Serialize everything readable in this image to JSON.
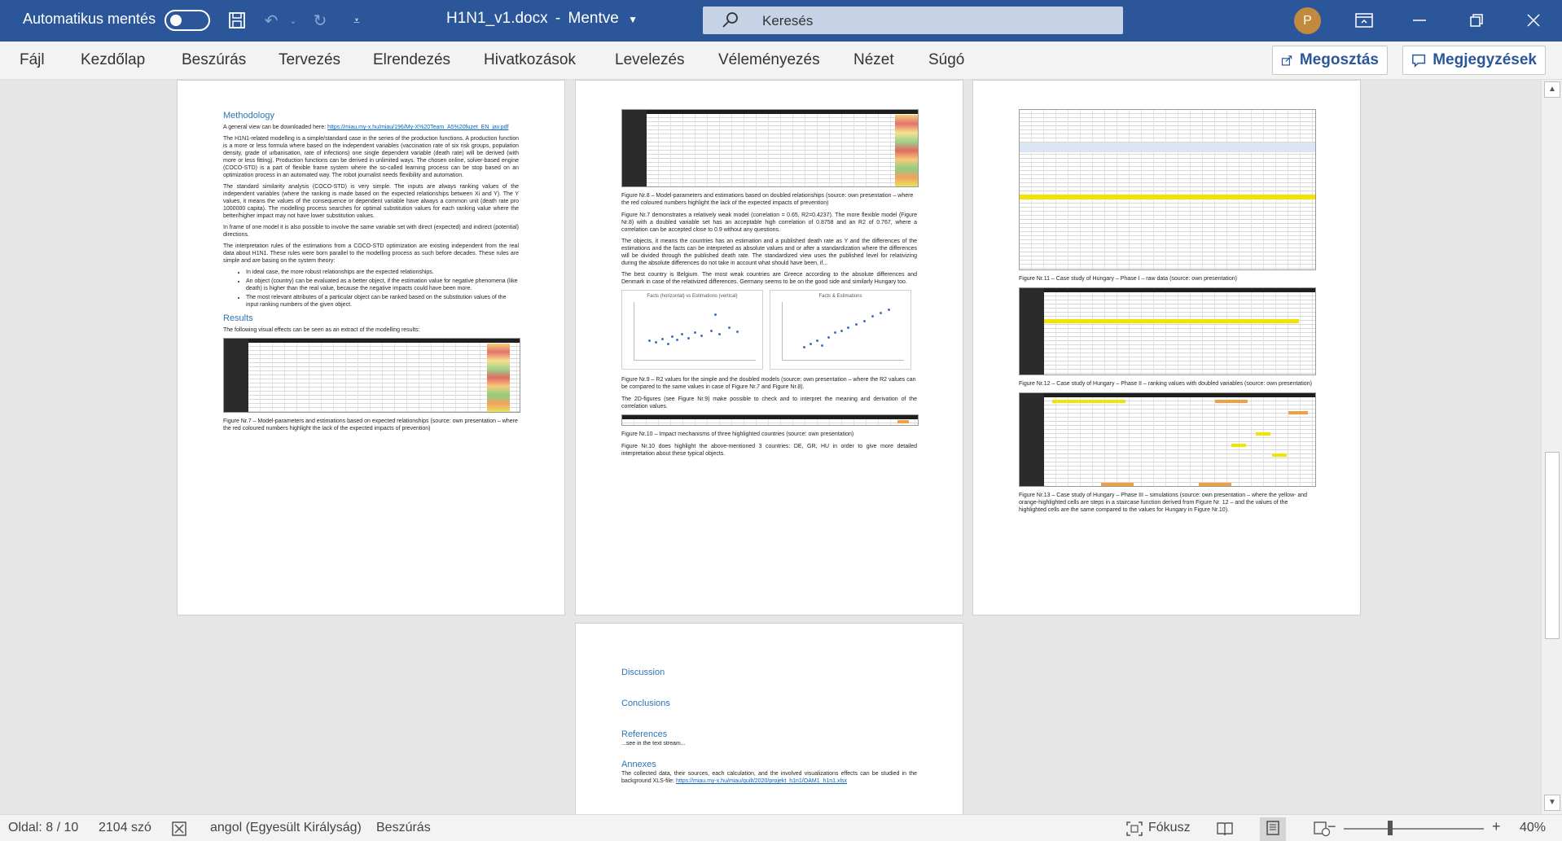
{
  "titlebar": {
    "autosave_label": "Automatikus mentés",
    "autosave_state": "off",
    "doc_title": "H1N1_v1.docx",
    "save_state": "Mentve",
    "search_label": "Keresés",
    "avatar_initial": "P"
  },
  "ribbon": {
    "tabs": [
      "Fájl",
      "Kezdőlap",
      "Beszúrás",
      "Tervezés",
      "Elrendezés",
      "Hivatkozások",
      "Levelezés",
      "Véleményezés",
      "Nézet",
      "Súgó"
    ],
    "share_label": "Megosztás",
    "comments_label": "Megjegyzések"
  },
  "page1": {
    "methodology_heading": "Methodology",
    "download_text": "A general view can be downloaded here:",
    "download_link": "https://miau.my-x.hu/miau/196/My-X%20Team_A5%20fuzet_EN_jav.pdf",
    "p1": "The H1N1-related modelling is a simple/standard case in the series of the production functions. A production function is a more or less formula where based on the independent variables (vaccination rate of six risk groups, population density, grade of urbanisation, rate of infections) one single dependent variable (death rate) will be derived (with more or less fitting). Production functions can be derived in unlimited ways. The chosen online, solver-based engine (COCO-STD) is a part of flexible frame system where the so-called learning process can be stop based on an optimization process in an automated way. The robot journalist needs flexibility and automation.",
    "p2": "The standard similarity analysis (COCO-STD) is very simple. The inputs are always ranking values of the independent variables (where the ranking is made based on the expected relationships between Xi and Y). The Y values, it means the values of the consequence or dependent variable have always a common unit (death rate pro 1000000 capita). The modelling process searches for optimal substitution values for each ranking value where the better/higher impact may not have lower substitution values.",
    "p3": "In frame of one model it is also possible to involve the same variable set with direct (expected) and indirect (potential) directions.",
    "p4": "The interpretation rules of the estimations from a COCO-STD optimization are existing independent from the real data about H1N1. These rules were born parallel to the modelling process as such before decades. These rules are simple and are basing on the system theory:",
    "bullets": [
      "In ideal case, the more robust relationships are the expected relationships.",
      "An object (country) can be evaluated as a better object, if the estimation value for negative phenomena (like death) is higher than the real value, because the negative impacts could have been more.",
      "The most relevant attributes of a particular object can be ranked based on the substitution values of the input ranking numbers of the given object."
    ],
    "results_heading": "Results",
    "results_text": "The following visual effects can be seen as an extract of the modelling results:",
    "fig7_caption": "Figure Nr.7 – Model-parameters and estimations based on expected relationships (source: own presentation – where the red coloured numbers highlight the lack of the expected impacts of prevention)"
  },
  "page2": {
    "fig8_caption": "Figure Nr.8 – Model-parameters and estimations based on doubled relationships (source: own presentation – where the red coloured numbers highlight the lack of the expected impacts of prevention)",
    "p1": "Figure Nr.7 demonstrates a relatively weak model (correlation = 0.65, R2=0.4237). The more flexible model (Figure Nr.8) with a doubled variable set has an acceptable high correlation of 0.8758 and an R2 of 0.767, where a correlation can be accepted close to 0.9 without any questions.",
    "p2": "The objects, it means the countries has an estimation and a published death rate as Y and the differences of the estimations and the facts can be interpreted as absolute values and or after a standardization where the differences will be divided through the published death rate. The standardized view uses the published level for relativizing during the absolute differences do not take in account what should have been, if...",
    "p3": "The best country is Belgium. The most weak countries are Greece according to the absolute differences and Denmark in case of the relativized differences. Germany seems to be on the good side and similarly Hungary too.",
    "chart1_title": "Facts (horizontal) vs Estimations (vertical)",
    "chart2_title": "Facts & Estimations",
    "fig9_caption": "Figure Nr.9 – R2 values for the simple and the doubled models (source: own presentation – where the R2 values can be compared to the same values in case of Figure Nr.7 and Figure Nr.8).",
    "p4": "The 2D-figures (see Figure Nr.9) make possible to check and to interpret the meaning and derivation of the correlation values.",
    "fig10_caption": "Figure Nr.10 – Impact mechanisms of three highlighted countries (source: own presentation)",
    "p5": "Figure Nr.10 does highlight the above-mentioned 3 countries: DE, GR, HU in order to give more detailed interpretation about these typical objects."
  },
  "page3": {
    "fig11_caption": "Figure Nr.11 – Case study of Hungary – Phase I – raw data (source: own presentation)",
    "fig12_caption": "Figure Nr.12 – Case study of Hungary – Phase II – ranking values with doubled variables (source: own presentation)",
    "fig13_caption": "Figure Nr.13 – Case study of Hungary – Phase III – simulations (source: own presentation – where the yellow- and orange-highlighted cells are steps in a staircase function derived from Figure Nr. 12 – and the values of the highlighted cells are the same compared to the values for Hungary in Figure Nr.10)."
  },
  "page4": {
    "discussion": "Discussion",
    "conclusions": "Conclusions",
    "references": "References",
    "references_text": "...see in the text stream...",
    "annexes": "Annexes",
    "annexes_text": "The collected data, their sources, each calculation, and the involved visualizations effects can be studied in the background XLS-file:",
    "annexes_link": "https://miau.my-x.hu/miau/quilt/2020/projekt_h1n1/OAM1_h1n1.xlsx"
  },
  "statusbar": {
    "page": "Oldal: 8 / 10",
    "words": "2104 szó",
    "language": "angol (Egyesült Királyság)",
    "mode": "Beszúrás",
    "focus": "Fókusz",
    "zoom": "40%"
  },
  "colors": {
    "brand": "#2b579a",
    "heading": "#2e74b5",
    "link": "#0563c1",
    "highlight": "#f2e400"
  }
}
